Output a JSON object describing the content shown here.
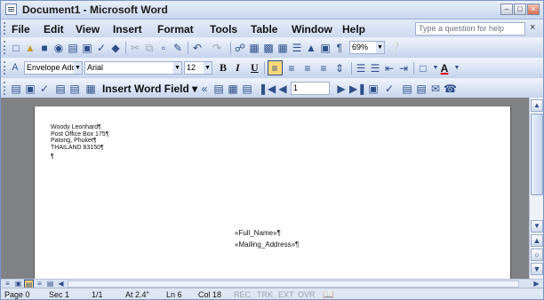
{
  "window": {
    "title": "Document1 - Microsoft Word"
  },
  "menu": {
    "items": [
      {
        "label": "File",
        "u": "F",
        "rest": "ile"
      },
      {
        "label": "Edit",
        "u": "E",
        "rest": "dit"
      },
      {
        "label": "View",
        "u": "V",
        "rest": "iew"
      },
      {
        "label": "Insert",
        "u": "I",
        "rest": "nsert"
      },
      {
        "label": "Format",
        "u": "o",
        "pre": "F",
        "rest": "rmat"
      },
      {
        "label": "Tools",
        "u": "T",
        "rest": "ools"
      },
      {
        "label": "Table",
        "u": "a",
        "pre": "T",
        "rest": "ble"
      },
      {
        "label": "Window",
        "u": "W",
        "rest": "indow"
      },
      {
        "label": "Help",
        "u": "H",
        "rest": "elp"
      }
    ],
    "ask_placeholder": "Type a question for help",
    "close_glyph": "×"
  },
  "standard_toolbar": {
    "zoom": "69%"
  },
  "formatting_toolbar": {
    "style": "Envelope Addre",
    "font": "Arial",
    "size": "12",
    "bold": "B",
    "italic": "I",
    "underline": "U",
    "font_color_glyph": "A"
  },
  "mail_merge_toolbar": {
    "insert_word_field": "Insert Word Field",
    "record": "1"
  },
  "document": {
    "address_lines": [
      "Woody Leonhard¶",
      "Post Office Box 175¶",
      "Patong, Phuket¶",
      "THAILAND 83150¶"
    ],
    "empty_para": "¶",
    "merge_fields": [
      "«Full_Name»¶",
      "«Mailing_Address»¶"
    ]
  },
  "status": {
    "page": "Page 0",
    "sec": "Sec 1",
    "pages": "1/1",
    "at": "At 2.4\"",
    "ln": "Ln 6",
    "col": "Col 18",
    "rec": "REC",
    "trk": "TRK",
    "ext": "EXT",
    "ovr": "OVR"
  },
  "colors": {
    "accent": "#2f4f8a",
    "toolbar": "#c5d3ec",
    "doc_bg": "#7f8185"
  }
}
